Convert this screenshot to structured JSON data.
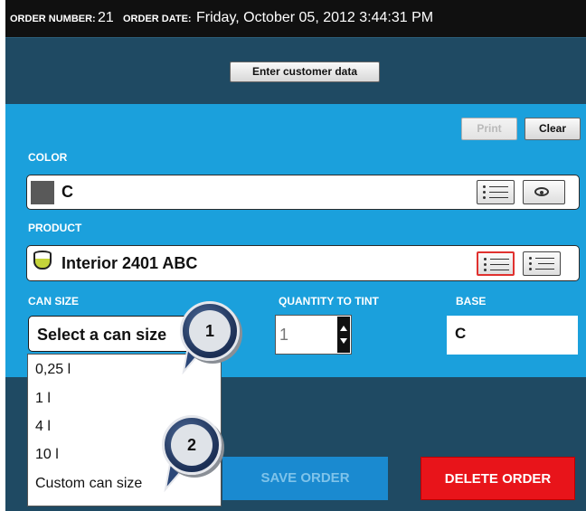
{
  "header": {
    "order_number_label": "ORDER NUMBER:",
    "order_number": "21",
    "order_date_label": "ORDER DATE:",
    "order_date": "Friday, October 05, 2012 3:44:31 PM"
  },
  "toolbar": {
    "enter_customer_label": "Enter customer data",
    "print_label": "Print",
    "clear_label": "Clear"
  },
  "color": {
    "section_label": "COLOR",
    "value": "C",
    "swatch_color": "#595959"
  },
  "product": {
    "section_label": "PRODUCT",
    "value": "Interior 2401 ABC"
  },
  "can_size": {
    "section_label": "CAN SIZE",
    "selected": "Select a can size",
    "options": [
      "0,25 l",
      "1 l",
      "4 l",
      "10 l",
      "Custom can size"
    ]
  },
  "quantity": {
    "section_label": "QUANTITY TO TINT",
    "value": "1"
  },
  "base": {
    "section_label": "BASE",
    "value": "C"
  },
  "actions": {
    "save_label": "SAVE ORDER",
    "delete_label": "DELETE ORDER"
  },
  "callouts": [
    "1",
    "2"
  ],
  "colors": {
    "panel_blue": "#1ba0dc",
    "dark_teal": "#1f4a63",
    "delete_red": "#e8141a",
    "save_blue": "#1a8ad0"
  }
}
